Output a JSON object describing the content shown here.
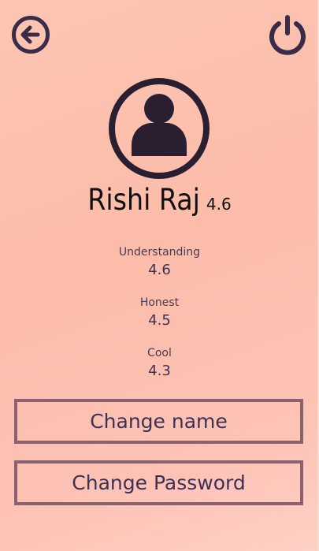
{
  "header": {
    "back_icon": "arrow-left-circle-icon",
    "power_icon": "power-icon"
  },
  "profile": {
    "avatar_icon": "user-circle-icon",
    "name": "Rishi Raj",
    "overall_rating": "4.6"
  },
  "traits": [
    {
      "label": "Understanding",
      "value": "4.6"
    },
    {
      "label": "Honest",
      "value": "4.5"
    },
    {
      "label": "Cool",
      "value": "4.3"
    }
  ],
  "actions": {
    "change_name": "Change name",
    "change_password": "Change Password"
  },
  "colors": {
    "icon": "#3a2b48",
    "button_border": "#8b6171",
    "button_text": "#3d3156"
  }
}
